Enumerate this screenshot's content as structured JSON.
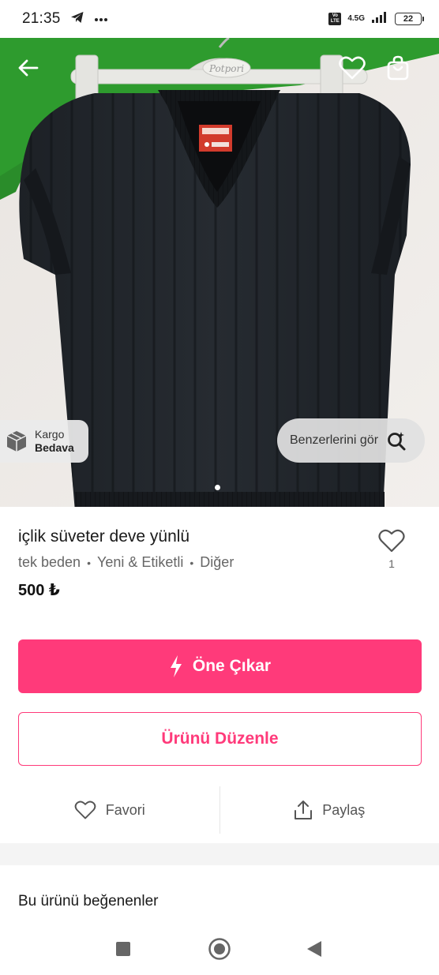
{
  "status_bar": {
    "time": "21:35",
    "network_label": "4.5G",
    "volte_label": "Vo LTE",
    "battery": "22",
    "icons": [
      "telegram-icon",
      "more-dots-icon",
      "signal-icon",
      "battery-icon"
    ]
  },
  "top_bar": {
    "icons": [
      "back-arrow-icon",
      "heart-outline-icon",
      "shopping-bag-icon"
    ]
  },
  "hero": {
    "hanger_brand": "Potpori",
    "image_description_icon": "sweater-photo",
    "kargo_line1": "Kargo",
    "kargo_line2": "Bedava",
    "similar_label": "Benzerlerini gör",
    "page_indicator": {
      "current": 1,
      "total": 1
    }
  },
  "product": {
    "title": "içlik süveter deve yünlü",
    "size": "tek beden",
    "condition": "Yeni & Etiketli",
    "brand": "Diğer",
    "separator": "•",
    "price": "500 ₺",
    "like_count": "1"
  },
  "buttons": {
    "promote_label": "Öne Çıkar",
    "edit_label": "Ürünü Düzenle"
  },
  "actions": {
    "favorite_label": "Favori",
    "share_label": "Paylaş"
  },
  "likers": {
    "title": "Bu ürünü beğenenler"
  },
  "colors": {
    "accent": "#ff3a7a",
    "text_primary": "#1a1a1a",
    "text_secondary": "#666666"
  }
}
